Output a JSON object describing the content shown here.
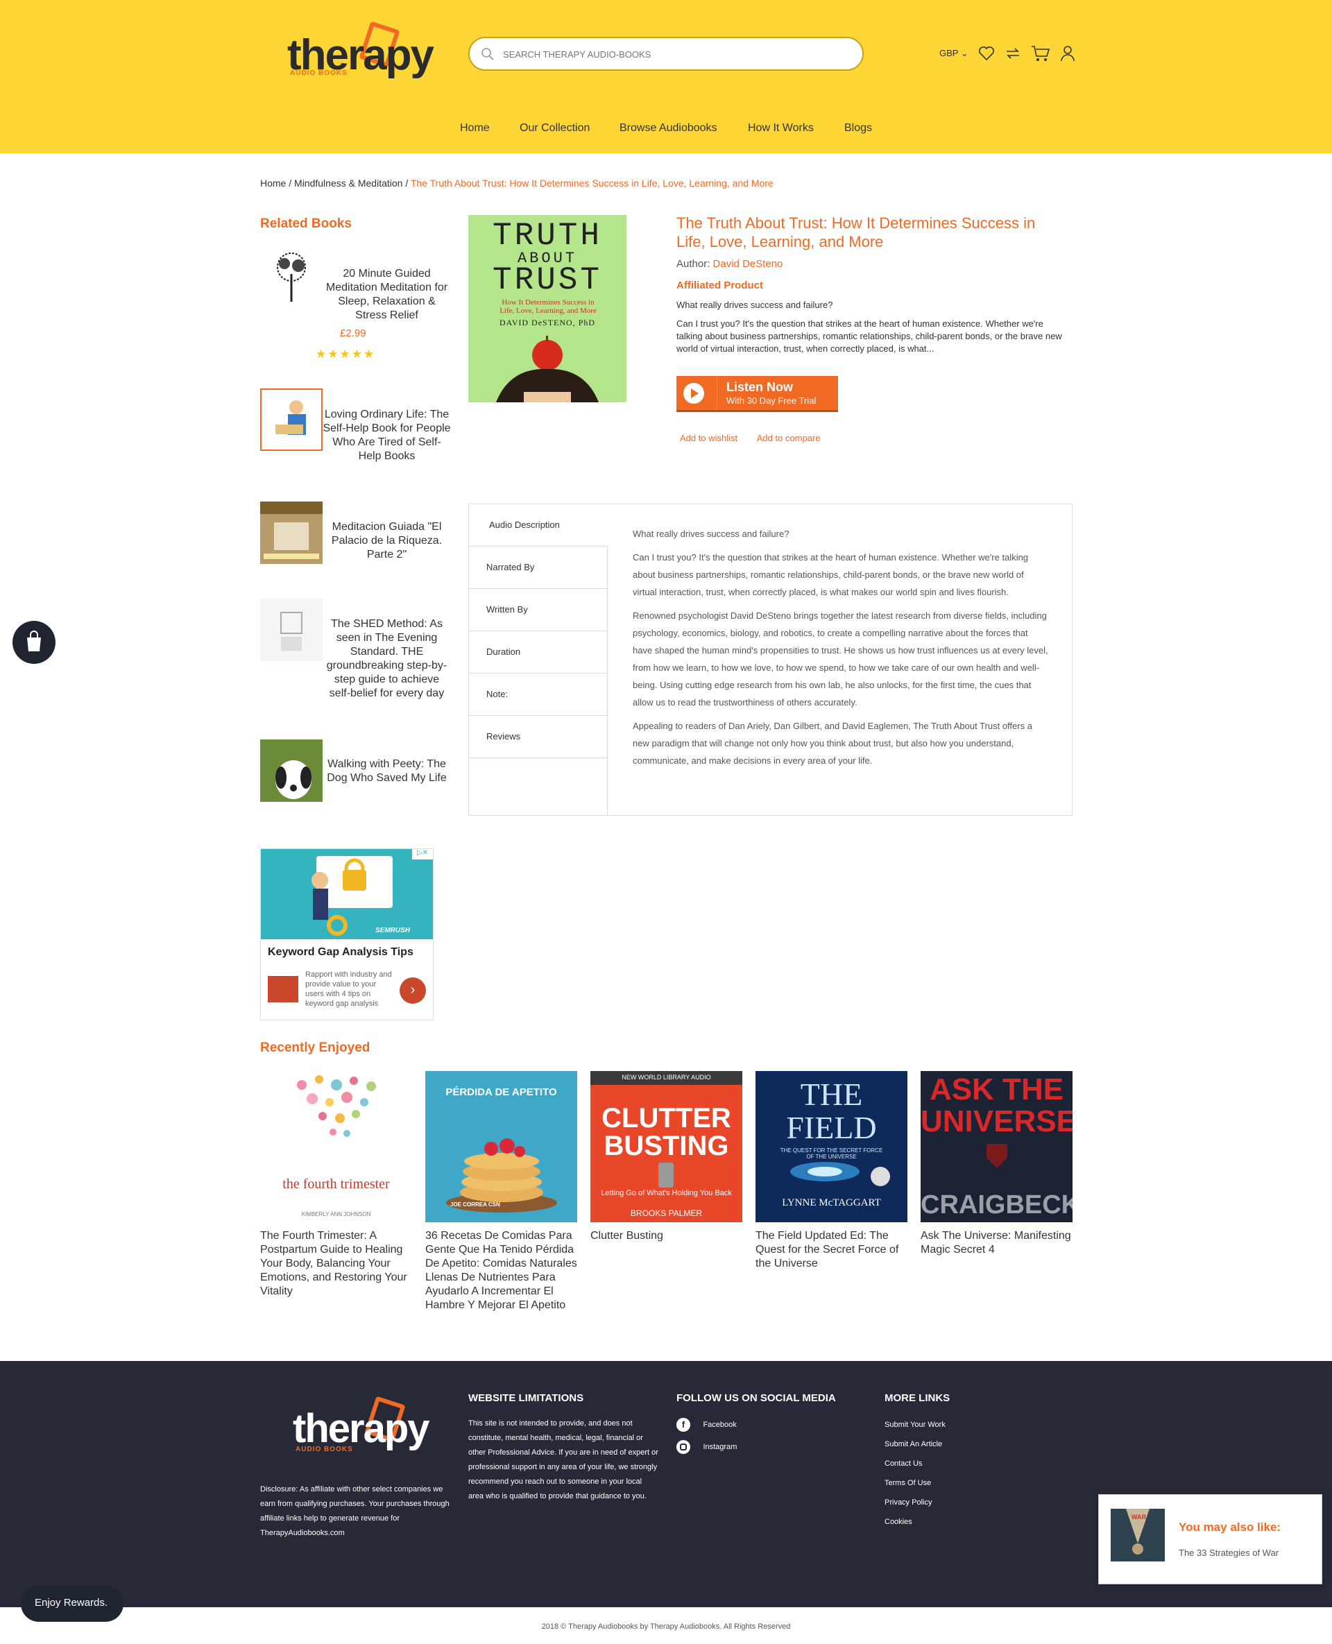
{
  "header": {
    "logo_text": "therapy",
    "logo_sub": "AUDIO BOOKS",
    "search_placeholder": "SEARCH THERAPY AUDIO-BOOKS",
    "currency": "GBP",
    "nav": [
      "Home",
      "Our Collection",
      "Browse Audiobooks",
      "How It Works",
      "Blogs"
    ]
  },
  "breadcrumb": {
    "home": "Home",
    "category": "Mindfulness & Meditation",
    "current": "The Truth About Trust: How It Determines Success in Life, Love, Learning, and More"
  },
  "related": {
    "heading": "Related Books",
    "items": [
      {
        "title": "20 Minute Guided Meditation Meditation for Sleep, Relaxation & Stress Relief",
        "price": "£2.99",
        "stars": "★★★★★"
      },
      {
        "title": "Loving Ordinary Life: The Self-Help Book for People Who Are Tired of Self-Help Books"
      },
      {
        "title": "Meditacion Guiada \"El Palacio de la Riqueza. Parte 2\""
      },
      {
        "title": "The SHED Method: As seen in The Evening Standard. THE groundbreaking step-by-step guide to achieve self-belief for every day"
      },
      {
        "title": "Walking with Peety: The Dog Who Saved My Life"
      }
    ]
  },
  "product": {
    "cover_title_1": "TRUTH",
    "cover_title_2": "ABOUT",
    "cover_title_3": "TRUST",
    "cover_sub": "How It Determines Success in Life, Love, Learning, and More",
    "cover_author": "DAVID DeSTENO, PhD",
    "title": "The Truth About Trust: How It Determines Success in Life, Love, Learning, and More",
    "author_label": "Author:",
    "author": "David DeSteno",
    "affiliated": "Affiliated Product",
    "question": "What really drives success and failure?",
    "short_desc": "Can I trust you? It's the question that strikes at the heart of human existence. Whether we're talking about business partnerships, romantic relationships, child-parent bonds, or the brave new world of virtual interaction, trust, when correctly placed, is what...",
    "listen_label": "Listen Now",
    "listen_sub": "With 30 Day Free Trial",
    "wishlist": "Add to wishlist",
    "compare": "Add to compare"
  },
  "tabs": {
    "items": [
      "Audio Description",
      "Narrated By",
      "Written By",
      "Duration",
      "Note:",
      "Reviews"
    ],
    "paragraphs": [
      "What really drives success and failure?",
      "Can I trust you? It's the question that strikes at the heart of human existence. Whether we're talking about business partnerships, romantic relationships, child-parent bonds, or the brave new world of virtual interaction, trust, when correctly placed, is what makes our world spin and lives flourish.",
      "Renowned psychologist David DeSteno brings together the latest research from diverse fields, including psychology, economics, biology, and robotics, to create a compelling narrative about the forces that have shaped the human mind's propensities to trust. He shows us how trust influences us at every level, from how we learn, to how we love, to how we spend, to how we take care of our own health and well-being. Using cutting edge research from his own lab, he also unlocks, for the first time, the cues that allow us to read the trustworthiness of others accurately.",
      "Appealing to readers of Dan Ariely, Dan Gilbert, and David Eaglemen, The Truth About Trust offers a new paradigm that will change not only how you think about trust, but also how you understand, communicate, and make decisions in every area of your life."
    ]
  },
  "ad": {
    "brand": "SEMRUSH",
    "title": "Keyword Gap Analysis Tips",
    "desc": "Rapport with industry and provide value to your users with 4 tips on keyword gap analysis"
  },
  "recent": {
    "heading": "Recently Enjoyed",
    "items": [
      {
        "title": "The Fourth Trimester: A Postpartum Guide to Healing Your Body, Balancing Your Emotions, and Restoring Your Vitality",
        "cover_text": "the fourth trimester",
        "cover_author": "KIMBERLY ANN JOHNSON"
      },
      {
        "title": "36 Recetas De Comidas Para Gente Que Ha Tenido Pérdida De Apetito: Comidas Naturales Llenas De Nutrientes Para Ayudarlo A Incrementar El Hambre Y Mejorar El Apetito",
        "cover_text": "PÉRDIDA DE APETITO",
        "cover_author": "JOE CORREA CSN"
      },
      {
        "title": "Clutter Busting",
        "cover_top": "NEW WORLD LIBRARY AUDIO",
        "cover_text": "CLUTTER BUSTING",
        "cover_sub": "Letting Go of What's Holding You Back",
        "cover_author": "BROOKS PALMER"
      },
      {
        "title": "The Field Updated Ed: The Quest for the Secret Force of the Universe",
        "cover_text": "THE FIELD",
        "cover_sub": "THE QUEST FOR THE SECRET FORCE OF THE UNIVERSE",
        "cover_author": "LYNNE McTAGGART"
      },
      {
        "title": "Ask The Universe: Manifesting Magic Secret 4",
        "cover_text": "ASK THE UNIVERSE",
        "cover_author": "CRAIGBECK"
      }
    ]
  },
  "footer": {
    "disclosure": "Disclosure: As affiliate with other select companies we earn from qualifying purchases. Your purchases through affiliate links help to generate revenue for TherapyAudiobooks.com",
    "limitations_heading": "WEBSITE LIMITATIONS",
    "limitations_text": "This site is not intended to provide, and does not constitute, mental health, medical, legal, financial or other Professional Advice. If you are in need of expert or professional support in any area of your life, we strongly recommend you reach out to someone in your local area who is qualified to provide that guidance to you.",
    "social_heading": "FOLLOW US ON SOCIAL MEDIA",
    "social": [
      "Facebook",
      "Instagram"
    ],
    "links_heading": "MORE LINKS",
    "links": [
      "Submit Your Work",
      "Submit An Article",
      "Contact Us",
      "Terms Of Use",
      "Privacy Policy",
      "Cookies"
    ],
    "copyright": "2018 © Therapy Audiobooks by Therapy Audiobooks. All Rights Reserved"
  },
  "widgets": {
    "rewards": "Enjoy Rewards.",
    "popup_heading": "You may also like:",
    "popup_item": "The 33 Strategies of War",
    "popup_cover_text": "WAR"
  },
  "colors": {
    "brand_yellow": "#fdd535",
    "accent_orange": "#f06a24",
    "footer_bg": "#272a36"
  }
}
